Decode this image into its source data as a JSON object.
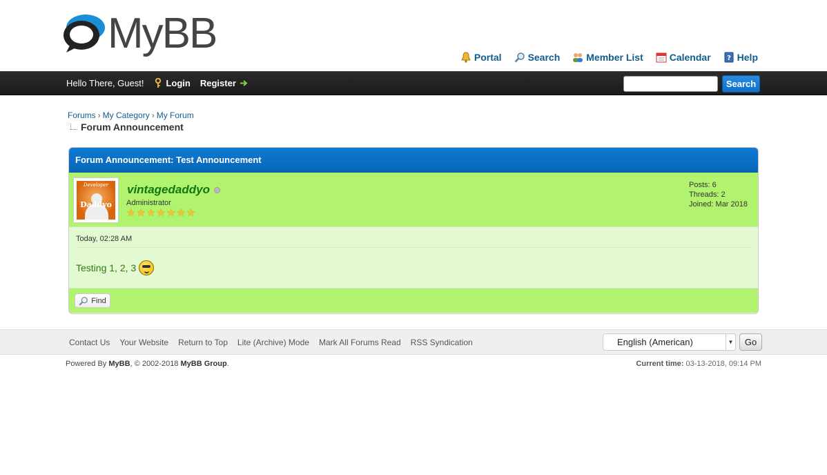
{
  "logo": {
    "text": "MyBB"
  },
  "top_links": [
    {
      "label": "Portal",
      "icon": "bell-icon"
    },
    {
      "label": "Search",
      "icon": "magnifier-icon"
    },
    {
      "label": "Member List",
      "icon": "members-icon"
    },
    {
      "label": "Calendar",
      "icon": "calendar-icon"
    },
    {
      "label": "Help",
      "icon": "help-book-icon"
    }
  ],
  "panel": {
    "greeting": "Hello There, Guest!",
    "login": "Login",
    "register": "Register",
    "search_button": "Search",
    "search_value": ""
  },
  "breadcrumb": {
    "items": [
      "Forums",
      "My Category",
      "My Forum"
    ],
    "separator": "›",
    "active": "Forum Announcement"
  },
  "announcement": {
    "title": "Forum Announcement: Test Announcement",
    "avatar_top": "Developer",
    "avatar_name": "Daddyo",
    "username": "vintagedaddyo",
    "usertitle": "Administrator",
    "stars": 7,
    "stats": {
      "posts": "Posts: 6",
      "threads": "Threads: 2",
      "joined": "Joined: Mar 2018"
    },
    "date": "Today, 02:28 AM",
    "message": "Testing 1, 2, 3",
    "find_label": "Find"
  },
  "footer": {
    "links": [
      "Contact Us",
      "Your Website",
      "Return to Top",
      "Lite (Archive) Mode",
      "Mark All Forums Read",
      "RSS Syndication"
    ],
    "language": "English (American)",
    "go_label": "Go",
    "powered_prefix": "Powered By ",
    "powered_name": "MyBB",
    "powered_mid": ", © 2002-2018 ",
    "powered_group": "MyBB Group",
    "powered_end": ".",
    "current_time_label": "Current time:",
    "current_time": "03-13-2018, 09:14 PM"
  },
  "colors": {
    "brand_blue": "#0f5c8e",
    "header_blue": "#0f7ad4",
    "post_green": "#b1f26e",
    "post_light": "#e2f9d2",
    "username_green": "#117811"
  }
}
